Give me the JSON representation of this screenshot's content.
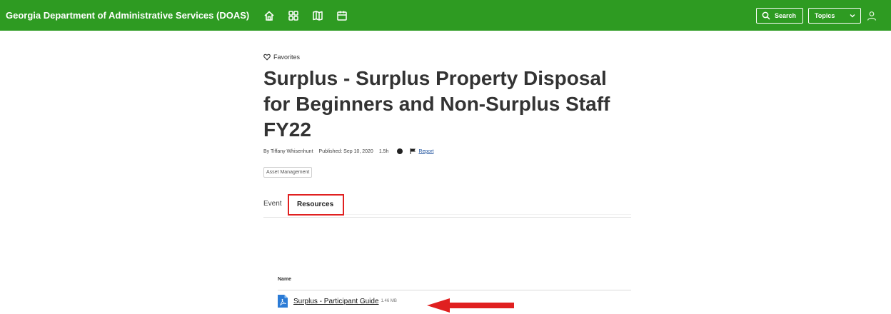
{
  "header": {
    "site_title": "Georgia Department of Administrative Services (DOAS)",
    "nav_icons": [
      "home-icon",
      "apps-grid-icon",
      "map-icon",
      "calendar-icon"
    ],
    "search_label": "Search",
    "topics_label": "Topics",
    "background_color": "#2e9b22"
  },
  "page": {
    "favorites_label": "Favorites",
    "title": "Surplus - Surplus Property Disposal for Beginners and Non-Surplus Staff FY22",
    "meta": {
      "author": "By Tiffany Whisenhunt",
      "published": "Published: Sep 10, 2020",
      "duration": "1.5h",
      "report_label": "Report"
    },
    "tag": "Asset Management",
    "tabs": [
      {
        "label": "Event",
        "selected": false
      },
      {
        "label": "Resources",
        "selected": true
      }
    ]
  },
  "resources": {
    "column_header": "Name",
    "files": [
      {
        "name": "Surplus - Participant Guide",
        "size": "1.46 MB",
        "icon": "pdf-file-icon"
      }
    ]
  },
  "annotations": {
    "highlight_color": "#e02020"
  }
}
